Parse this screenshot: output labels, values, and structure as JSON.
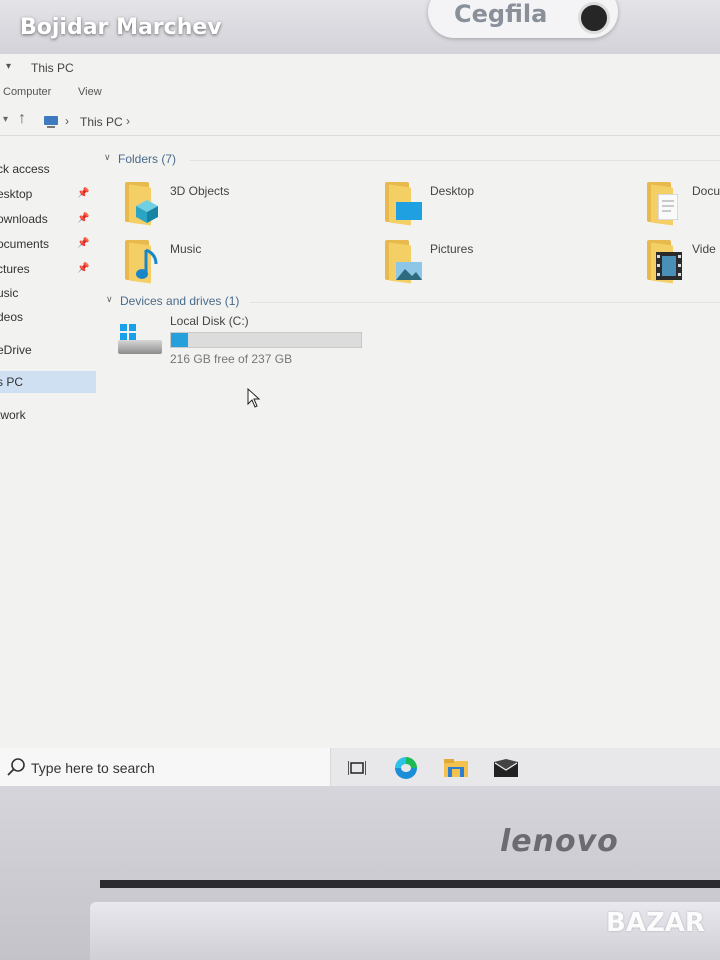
{
  "overlay": {
    "seller_name": "Bojidar Marchev"
  },
  "camera": {
    "shutter_label": "Cegfila"
  },
  "window": {
    "title": "This PC",
    "ribbon_tabs": [
      "Computer",
      "View"
    ]
  },
  "address": {
    "crumbs": [
      "This PC"
    ]
  },
  "nav_pane": {
    "items": [
      {
        "label": "ck access",
        "pinned": false,
        "selected": false
      },
      {
        "label": "esktop",
        "pinned": true,
        "selected": false
      },
      {
        "label": "ownloads",
        "pinned": true,
        "selected": false
      },
      {
        "label": "ocuments",
        "pinned": true,
        "selected": false
      },
      {
        "label": "ctures",
        "pinned": true,
        "selected": false
      },
      {
        "label": "usic",
        "pinned": false,
        "selected": false
      },
      {
        "label": "deos",
        "pinned": false,
        "selected": false
      },
      {
        "label": "eDrive",
        "pinned": false,
        "selected": false
      },
      {
        "label": "s PC",
        "pinned": false,
        "selected": true
      },
      {
        "label": "twork",
        "pinned": false,
        "selected": false
      }
    ]
  },
  "folders_group": {
    "header": "Folders (7)",
    "items": [
      {
        "label": "3D Objects",
        "badge": "cube-icon"
      },
      {
        "label": "Desktop",
        "badge": "desktop-icon"
      },
      {
        "label": "Docu",
        "badge": "document-icon"
      },
      {
        "label": "Music",
        "badge": "music-note-icon"
      },
      {
        "label": "Pictures",
        "badge": "landscape-icon"
      },
      {
        "label": "Vide",
        "badge": "film-icon"
      }
    ]
  },
  "drives_group": {
    "header": "Devices and drives (1)",
    "drive": {
      "label": "Local Disk (C:)",
      "free_text": "216 GB free of 237 GB",
      "used_fraction": 0.089
    }
  },
  "taskbar": {
    "search_placeholder": "Type here to search",
    "buttons": [
      "task-view-icon",
      "edge-icon",
      "file-explorer-icon",
      "mail-icon"
    ]
  },
  "laptop": {
    "brand": "lenovo"
  },
  "watermark": {
    "text": "BAZAR"
  },
  "colors": {
    "accent": "#26a0da",
    "folder": "#f4cf66",
    "selection": "#cfe0f2",
    "taskbar_active": "#2b7bd6"
  }
}
